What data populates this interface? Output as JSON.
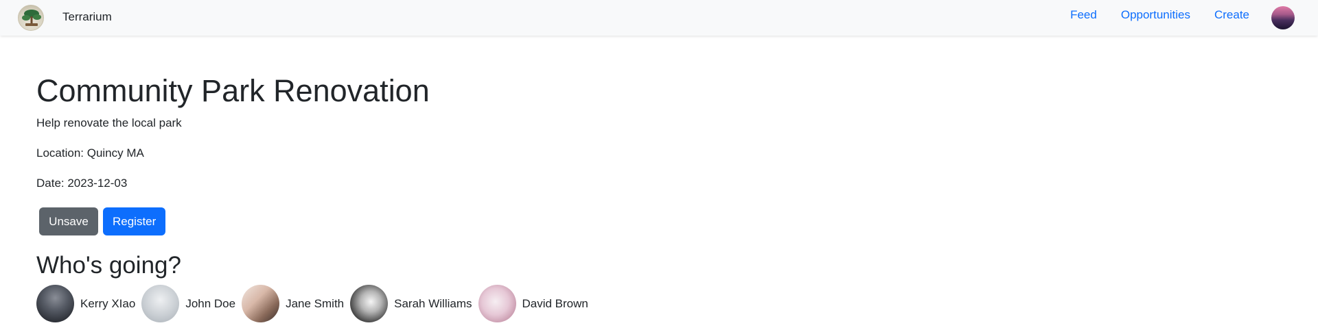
{
  "navbar": {
    "brand_logo_icon": "bonsai-tree-logo",
    "brand_name": "Terrarium",
    "links": [
      "Feed",
      "Opportunities",
      "Create"
    ],
    "avatar_icon": "user-avatar"
  },
  "event": {
    "title": "Community Park Renovation",
    "description": "Help renovate the local park",
    "location": "Location: Quincy MA",
    "date": "Date: 2023-12-03"
  },
  "actions": {
    "unsave_label": "Unsave",
    "register_label": "Register"
  },
  "attendees": {
    "heading": "Who's going?",
    "people": [
      {
        "name": "Kerry XIao"
      },
      {
        "name": "John Doe"
      },
      {
        "name": "Jane Smith"
      },
      {
        "name": "Sarah Williams"
      },
      {
        "name": "David Brown"
      }
    ]
  },
  "colors": {
    "link": "#0d6efd",
    "secondary_button": "#5c636a",
    "primary_button": "#0d6efd",
    "navbar_bg": "#f8f9fa"
  }
}
